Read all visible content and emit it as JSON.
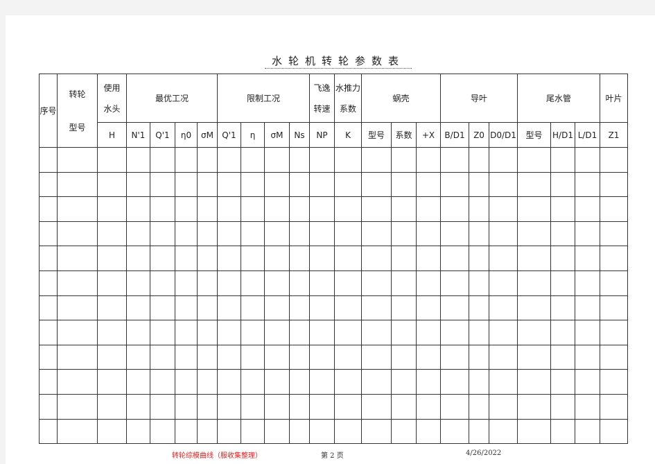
{
  "title": "水轮机转轮参数表",
  "header": {
    "seq": "序号",
    "runner_model_line1": "转轮",
    "runner_model_line2": "型号",
    "head_line1": "使用",
    "head_line2": "水头",
    "optimal": "最优工况",
    "limit": "限制工况",
    "runaway_line1": "飞逸",
    "runaway_line2": "转速",
    "thrust_line1": "水推力",
    "thrust_line2": "系数",
    "volute": "蜗壳",
    "guide_vane": "导叶",
    "draft_tube": "尾水管",
    "blade": "叶片"
  },
  "subheaders": [
    "H",
    "N'1",
    "Q'1",
    "η0",
    "σM",
    "Q'1",
    "η",
    "σM",
    "Ns",
    "NP",
    "K",
    "型号",
    "系数",
    "+X",
    "B/D1",
    "Z0",
    "D0/D1",
    "型号",
    "H/D1",
    "L/D1",
    "Z1"
  ],
  "data_rows": 12,
  "footer": {
    "left": "转轮综模曲线（服收集整理）",
    "page": "第 2 页",
    "date": "4/26/2022"
  }
}
